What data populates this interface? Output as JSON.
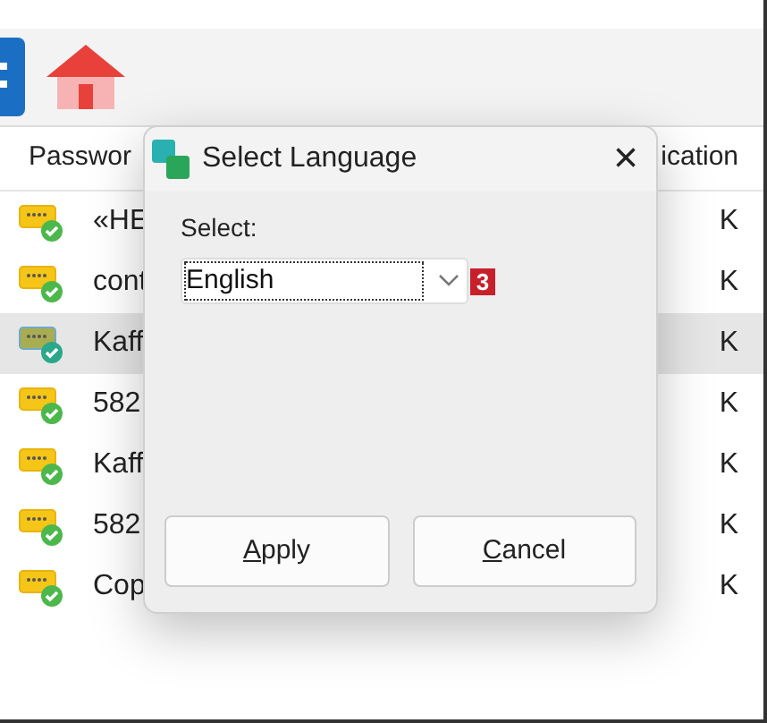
{
  "table": {
    "columns": [
      {
        "label": "Passwor"
      },
      {
        "label": "ication"
      }
    ],
    "rows": [
      {
        "name": "«HE",
        "column_2": "K",
        "selected": false
      },
      {
        "name": "cont",
        "column_2": "K",
        "selected": false
      },
      {
        "name": "Kaff",
        "column_2": "K",
        "selected": true
      },
      {
        "name": "582",
        "column_2": "K",
        "selected": false
      },
      {
        "name": "Kaff",
        "column_2": "K",
        "selected": false
      },
      {
        "name": "582",
        "column_2": "K",
        "selected": false
      },
      {
        "name": "Cop",
        "column_2": "K",
        "selected": false
      }
    ]
  },
  "dialog": {
    "title": "Select Language",
    "close": "×",
    "select_label": "Select:",
    "select_value": "English",
    "badge": "3",
    "buttons": [
      {
        "label": "Apply",
        "underline_first": true
      },
      {
        "label": "Cancel",
        "underline_first": true
      }
    ]
  }
}
